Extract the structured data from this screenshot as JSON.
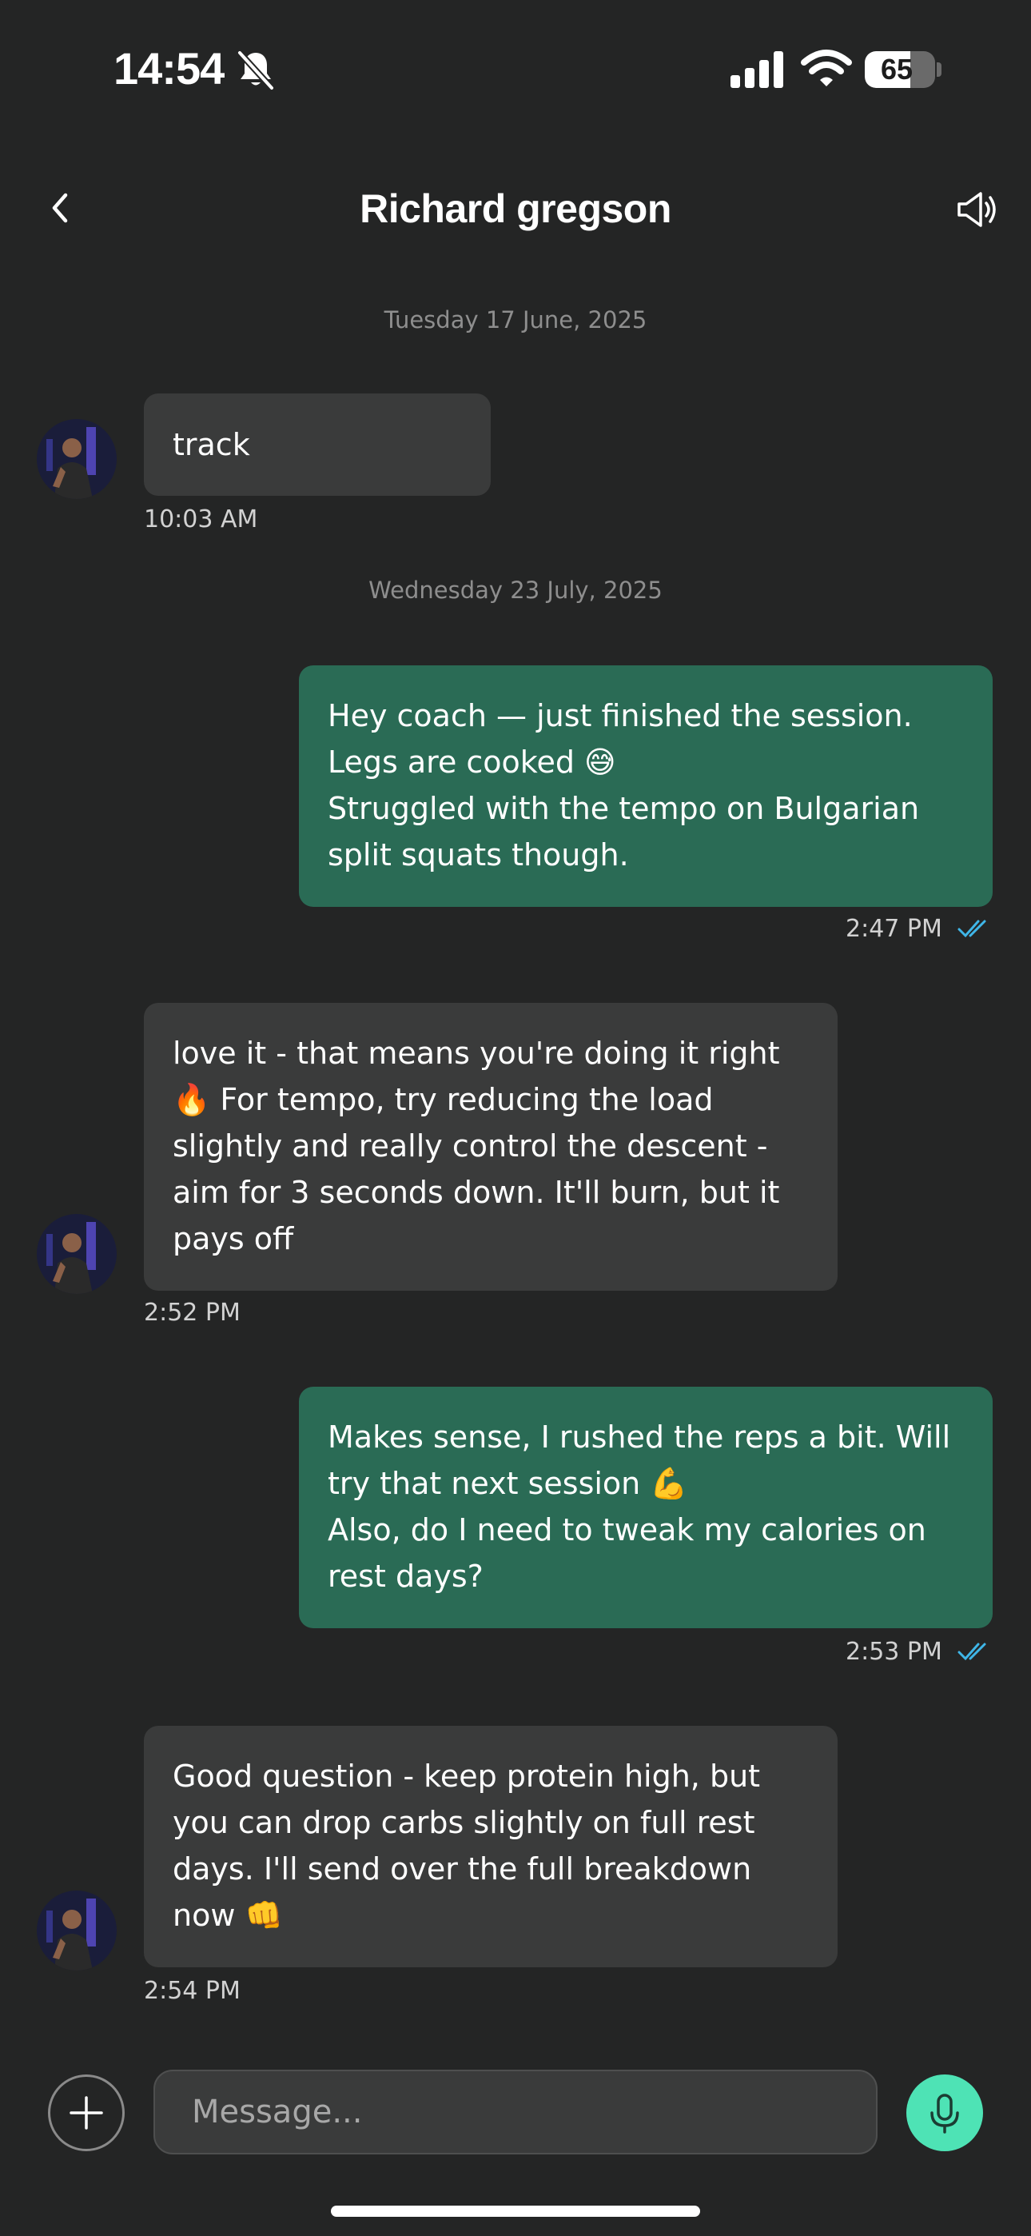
{
  "status_bar": {
    "time": "14:54",
    "battery_level": "65",
    "battery_fraction": 0.65,
    "icons": [
      "bell-slash-icon",
      "cellular-signal-icon",
      "wifi-icon",
      "battery-icon"
    ]
  },
  "header": {
    "title": "Richard gregson",
    "back_icon": "chevron-left-icon",
    "action_icon": "speaker-icon"
  },
  "date_separators": [
    "Tuesday 17 June, 2025",
    "Wednesday 23 July, 2025"
  ],
  "messages": [
    {
      "direction": "incoming",
      "text": "track",
      "time": "10:03 AM"
    },
    {
      "direction": "outgoing",
      "text": "Hey coach — just finished the session.\nLegs are cooked 😅\nStruggled with the tempo on Bulgarian\nsplit squats though.",
      "time": "2:47 PM",
      "status": "read"
    },
    {
      "direction": "incoming",
      "text": "love it - that means you're doing it right\n🔥 For tempo, try reducing the load\nslightly and really control the descent -\naim for 3 seconds down. It'll burn, but it\npays off",
      "time": "2:52 PM"
    },
    {
      "direction": "outgoing",
      "text": "Makes sense, I rushed the reps a bit. Will\ntry that next session 💪\nAlso, do I need to tweak my calories on\nrest days?",
      "time": "2:53 PM",
      "status": "read"
    },
    {
      "direction": "incoming",
      "text": "Good question - keep protein high, but\nyou can drop carbs slightly on full rest\ndays. I'll send over the full breakdown\nnow 👊",
      "time": "2:54 PM"
    }
  ],
  "composer": {
    "placeholder": "Message...",
    "value": "",
    "add_icon": "plus-icon",
    "mic_icon": "microphone-icon"
  },
  "colors": {
    "background": "#242525",
    "incoming_bubble": "#3a3b3b",
    "outgoing_bubble": "#2a6b55",
    "accent": "#4ee3b5",
    "read_tick": "#3fb6e8"
  }
}
